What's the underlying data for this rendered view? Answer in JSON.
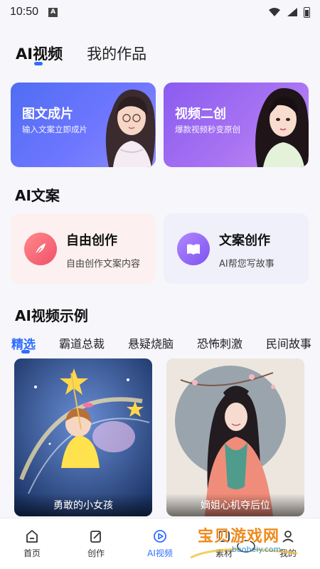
{
  "status_bar": {
    "time": "10:50",
    "notification_icon": "A"
  },
  "top_tabs": [
    {
      "label": "AI视频",
      "active": true
    },
    {
      "label": "我的作品",
      "active": false
    }
  ],
  "feature_cards": [
    {
      "title": "图文成片",
      "subtitle": "输入文案立即成片"
    },
    {
      "title": "视频二创",
      "subtitle": "爆款视频秒变原创"
    }
  ],
  "copy_section": {
    "title": "AI文案",
    "cards": [
      {
        "title": "自由创作",
        "subtitle": "自由创作文案内容",
        "icon": "feather-icon"
      },
      {
        "title": "文案创作",
        "subtitle": "AI帮您写故事",
        "icon": "book-icon"
      }
    ]
  },
  "examples_section": {
    "title": "AI视频示例",
    "categories": [
      "精选",
      "霸道总裁",
      "悬疑烧脑",
      "恐怖刺激",
      "民间故事"
    ],
    "active_category": "精选",
    "items": [
      {
        "caption": "勇敢的小女孩"
      },
      {
        "caption": "嫡姐心机夺后位"
      }
    ]
  },
  "bottom_nav": [
    {
      "label": "首页",
      "icon": "home-icon",
      "active": false
    },
    {
      "label": "创作",
      "icon": "edit-icon",
      "active": false
    },
    {
      "label": "AI视频",
      "icon": "play-icon",
      "active": true
    },
    {
      "label": "素材",
      "icon": "material-icon",
      "active": false
    },
    {
      "label": "我的",
      "icon": "profile-icon",
      "active": false
    }
  ],
  "watermark": {
    "text": "宝贝游戏网",
    "url": "baobeiy.com"
  },
  "colors": {
    "accent": "#2f6dff",
    "card_blue": "#5a6ff5",
    "card_purple": "#9a68f0"
  }
}
